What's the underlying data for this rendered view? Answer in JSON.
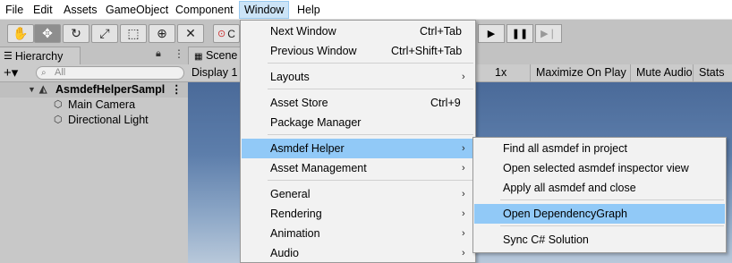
{
  "menubar": {
    "items": [
      "File",
      "Edit",
      "Assets",
      "GameObject",
      "Component",
      "Window",
      "Help"
    ]
  },
  "toolbar": {
    "tools": [
      "hand-icon",
      "move-icon",
      "rotate-icon",
      "scale-icon",
      "rect-tool-icon",
      "transform-icon",
      "custom-tool-icon"
    ],
    "pivot_label": "C",
    "play_controls": [
      "play-icon",
      "pause-icon",
      "step-icon"
    ]
  },
  "hierarchy": {
    "tab": "Hierarchy",
    "add": "+▾",
    "search_placeholder": "All",
    "scene": "AsmdefHelperSampl",
    "objects": [
      "Main Camera",
      "Directional Light"
    ]
  },
  "scene_tab": "Scene",
  "game_bar": {
    "display": "Display 1",
    "scale": "1x",
    "maximize": "Maximize On Play",
    "mute": "Mute Audio",
    "stats": "Stats"
  },
  "window_menu": {
    "items": [
      {
        "label": "Next Window",
        "shortcut": "Ctrl+Tab"
      },
      {
        "label": "Previous Window",
        "shortcut": "Ctrl+Shift+Tab"
      },
      {
        "label": "Layouts",
        "submenu": true
      },
      {
        "label": "Asset Store",
        "shortcut": "Ctrl+9"
      },
      {
        "label": "Package Manager"
      },
      {
        "label": "Asmdef Helper",
        "submenu": true,
        "highlighted": true
      },
      {
        "label": "Asset Management",
        "submenu": true
      },
      {
        "label": "General",
        "submenu": true
      },
      {
        "label": "Rendering",
        "submenu": true
      },
      {
        "label": "Animation",
        "submenu": true
      },
      {
        "label": "Audio",
        "submenu": true
      }
    ]
  },
  "asmdef_submenu": {
    "items": [
      {
        "label": "Find all asmdef in project"
      },
      {
        "label": "Open selected asmdef inspector view"
      },
      {
        "label": "Apply all asmdef and close"
      },
      {
        "label": "Open DependencyGraph",
        "highlighted": true
      },
      {
        "label": "Sync C# Solution"
      }
    ]
  },
  "colors": {
    "menu_highlight": "#91c9f7",
    "menubar_active": "#cce4f7",
    "sky_top": "#4a6a99",
    "sky_bottom": "#b8c8da"
  }
}
